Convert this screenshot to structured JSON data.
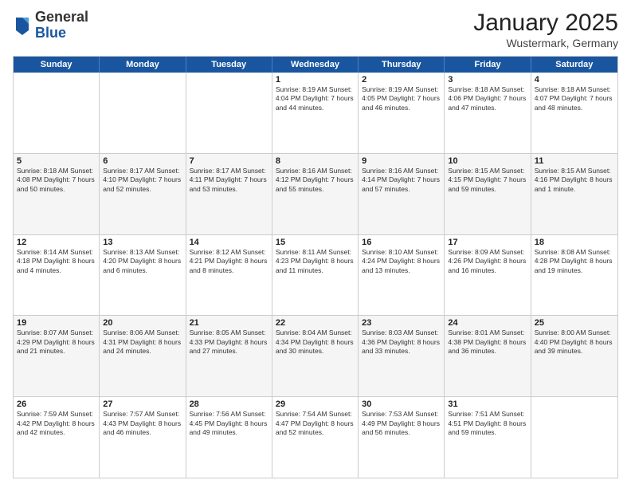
{
  "header": {
    "logo": {
      "general": "General",
      "blue": "Blue"
    },
    "title": "January 2025",
    "location": "Wustermark, Germany"
  },
  "weekdays": [
    "Sunday",
    "Monday",
    "Tuesday",
    "Wednesday",
    "Thursday",
    "Friday",
    "Saturday"
  ],
  "rows": [
    {
      "alt": false,
      "cells": [
        {
          "day": "",
          "info": ""
        },
        {
          "day": "",
          "info": ""
        },
        {
          "day": "",
          "info": ""
        },
        {
          "day": "1",
          "info": "Sunrise: 8:19 AM\nSunset: 4:04 PM\nDaylight: 7 hours\nand 44 minutes."
        },
        {
          "day": "2",
          "info": "Sunrise: 8:19 AM\nSunset: 4:05 PM\nDaylight: 7 hours\nand 46 minutes."
        },
        {
          "day": "3",
          "info": "Sunrise: 8:18 AM\nSunset: 4:06 PM\nDaylight: 7 hours\nand 47 minutes."
        },
        {
          "day": "4",
          "info": "Sunrise: 8:18 AM\nSunset: 4:07 PM\nDaylight: 7 hours\nand 48 minutes."
        }
      ]
    },
    {
      "alt": true,
      "cells": [
        {
          "day": "5",
          "info": "Sunrise: 8:18 AM\nSunset: 4:08 PM\nDaylight: 7 hours\nand 50 minutes."
        },
        {
          "day": "6",
          "info": "Sunrise: 8:17 AM\nSunset: 4:10 PM\nDaylight: 7 hours\nand 52 minutes."
        },
        {
          "day": "7",
          "info": "Sunrise: 8:17 AM\nSunset: 4:11 PM\nDaylight: 7 hours\nand 53 minutes."
        },
        {
          "day": "8",
          "info": "Sunrise: 8:16 AM\nSunset: 4:12 PM\nDaylight: 7 hours\nand 55 minutes."
        },
        {
          "day": "9",
          "info": "Sunrise: 8:16 AM\nSunset: 4:14 PM\nDaylight: 7 hours\nand 57 minutes."
        },
        {
          "day": "10",
          "info": "Sunrise: 8:15 AM\nSunset: 4:15 PM\nDaylight: 7 hours\nand 59 minutes."
        },
        {
          "day": "11",
          "info": "Sunrise: 8:15 AM\nSunset: 4:16 PM\nDaylight: 8 hours\nand 1 minute."
        }
      ]
    },
    {
      "alt": false,
      "cells": [
        {
          "day": "12",
          "info": "Sunrise: 8:14 AM\nSunset: 4:18 PM\nDaylight: 8 hours\nand 4 minutes."
        },
        {
          "day": "13",
          "info": "Sunrise: 8:13 AM\nSunset: 4:20 PM\nDaylight: 8 hours\nand 6 minutes."
        },
        {
          "day": "14",
          "info": "Sunrise: 8:12 AM\nSunset: 4:21 PM\nDaylight: 8 hours\nand 8 minutes."
        },
        {
          "day": "15",
          "info": "Sunrise: 8:11 AM\nSunset: 4:23 PM\nDaylight: 8 hours\nand 11 minutes."
        },
        {
          "day": "16",
          "info": "Sunrise: 8:10 AM\nSunset: 4:24 PM\nDaylight: 8 hours\nand 13 minutes."
        },
        {
          "day": "17",
          "info": "Sunrise: 8:09 AM\nSunset: 4:26 PM\nDaylight: 8 hours\nand 16 minutes."
        },
        {
          "day": "18",
          "info": "Sunrise: 8:08 AM\nSunset: 4:28 PM\nDaylight: 8 hours\nand 19 minutes."
        }
      ]
    },
    {
      "alt": true,
      "cells": [
        {
          "day": "19",
          "info": "Sunrise: 8:07 AM\nSunset: 4:29 PM\nDaylight: 8 hours\nand 21 minutes."
        },
        {
          "day": "20",
          "info": "Sunrise: 8:06 AM\nSunset: 4:31 PM\nDaylight: 8 hours\nand 24 minutes."
        },
        {
          "day": "21",
          "info": "Sunrise: 8:05 AM\nSunset: 4:33 PM\nDaylight: 8 hours\nand 27 minutes."
        },
        {
          "day": "22",
          "info": "Sunrise: 8:04 AM\nSunset: 4:34 PM\nDaylight: 8 hours\nand 30 minutes."
        },
        {
          "day": "23",
          "info": "Sunrise: 8:03 AM\nSunset: 4:36 PM\nDaylight: 8 hours\nand 33 minutes."
        },
        {
          "day": "24",
          "info": "Sunrise: 8:01 AM\nSunset: 4:38 PM\nDaylight: 8 hours\nand 36 minutes."
        },
        {
          "day": "25",
          "info": "Sunrise: 8:00 AM\nSunset: 4:40 PM\nDaylight: 8 hours\nand 39 minutes."
        }
      ]
    },
    {
      "alt": false,
      "cells": [
        {
          "day": "26",
          "info": "Sunrise: 7:59 AM\nSunset: 4:42 PM\nDaylight: 8 hours\nand 42 minutes."
        },
        {
          "day": "27",
          "info": "Sunrise: 7:57 AM\nSunset: 4:43 PM\nDaylight: 8 hours\nand 46 minutes."
        },
        {
          "day": "28",
          "info": "Sunrise: 7:56 AM\nSunset: 4:45 PM\nDaylight: 8 hours\nand 49 minutes."
        },
        {
          "day": "29",
          "info": "Sunrise: 7:54 AM\nSunset: 4:47 PM\nDaylight: 8 hours\nand 52 minutes."
        },
        {
          "day": "30",
          "info": "Sunrise: 7:53 AM\nSunset: 4:49 PM\nDaylight: 8 hours\nand 56 minutes."
        },
        {
          "day": "31",
          "info": "Sunrise: 7:51 AM\nSunset: 4:51 PM\nDaylight: 8 hours\nand 59 minutes."
        },
        {
          "day": "",
          "info": ""
        }
      ]
    }
  ]
}
